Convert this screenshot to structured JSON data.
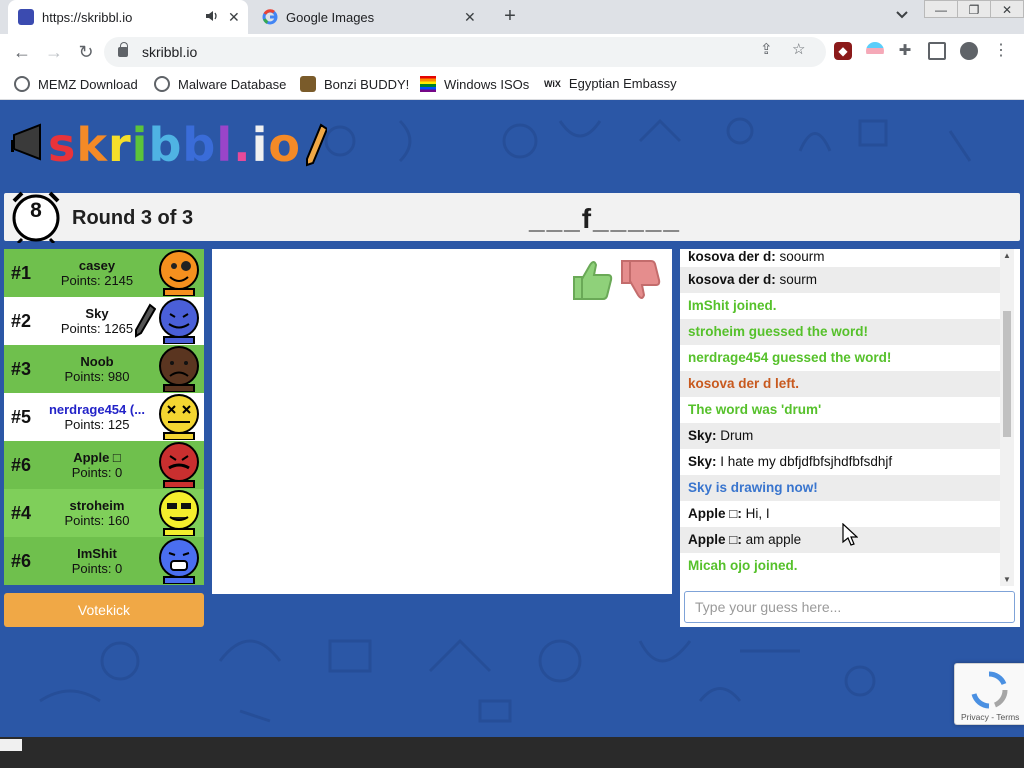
{
  "browser": {
    "tabs": [
      {
        "title": "https://skribbl.io",
        "active": true
      },
      {
        "title": "Google Images",
        "active": false
      }
    ],
    "new_tab_icon": "plus-icon",
    "url": "skribbl.io",
    "bookmarks": [
      {
        "label": "MEMZ Download"
      },
      {
        "label": "Malware Database"
      },
      {
        "label": "Bonzi BUDDY!"
      },
      {
        "label": "Windows ISOs"
      },
      {
        "label": "Egyptian Embassy"
      }
    ]
  },
  "game": {
    "logo_text": "skribbl.io",
    "timer": "8",
    "round": "Round 3 of 3",
    "word_hint": "___f_____",
    "players": [
      {
        "rank": "#1",
        "name": "casey",
        "points": "Points: 2145",
        "bg": "#6fc04d",
        "avatar_color": "#f5901e",
        "name_color": "#111111"
      },
      {
        "rank": "#2",
        "name": "Sky",
        "points": "Points: 1265",
        "bg": "#ffffff",
        "avatar_color": "#4a5fd8",
        "name_color": "#111111",
        "drawing": true
      },
      {
        "rank": "#3",
        "name": "Noob",
        "points": "Points: 980",
        "bg": "#6fc04d",
        "avatar_color": "#5a3520",
        "name_color": "#111111"
      },
      {
        "rank": "#5",
        "name": "nerdrage454 (...",
        "points": "Points: 125",
        "bg": "#ffffff",
        "avatar_color": "#f3d531",
        "name_color": "#2323c8"
      },
      {
        "rank": "#6",
        "name": "Apple □",
        "points": "Points: 0",
        "bg": "#6fc04d",
        "avatar_color": "#c92f2f",
        "name_color": "#111111"
      },
      {
        "rank": "#4",
        "name": "stroheim",
        "points": "Points: 160",
        "bg": "#7fcf5a",
        "avatar_color": "#f4ee2c",
        "name_color": "#111111"
      },
      {
        "rank": "#6",
        "name": "ImShit",
        "points": "Points: 0",
        "bg": "#6fc04d",
        "avatar_color": "#4a6ef0",
        "name_color": "#111111"
      }
    ],
    "votekick_label": "Votekick",
    "chat": [
      {
        "sender": "kosova der d:",
        "text": " soourm",
        "style": "normal"
      },
      {
        "sender": "kosova der d:",
        "text": " sourm",
        "style": "normal"
      },
      {
        "sender": "",
        "text": "ImShit joined.",
        "style": "green"
      },
      {
        "sender": "",
        "text": "stroheim guessed the word!",
        "style": "green"
      },
      {
        "sender": "",
        "text": "nerdrage454 guessed the word!",
        "style": "green"
      },
      {
        "sender": "",
        "text": "kosova der d left.",
        "style": "brown"
      },
      {
        "sender": "",
        "text": "The word was 'drum'",
        "style": "green"
      },
      {
        "sender": "Sky:",
        "text": " Drum",
        "style": "normal"
      },
      {
        "sender": "Sky:",
        "text": " I hate my dbfjdfbfsjhdfbfsdhjf",
        "style": "normal"
      },
      {
        "sender": "",
        "text": "Sky is drawing now!",
        "style": "blue"
      },
      {
        "sender": "Apple □:",
        "text": " Hi, I",
        "style": "normal"
      },
      {
        "sender": "Apple □:",
        "text": " am apple",
        "style": "normal"
      },
      {
        "sender": "",
        "text": "Micah ojo joined.",
        "style": "green"
      }
    ],
    "chat_placeholder": "Type your guess here...",
    "recaptcha_text": "Privacy - Terms"
  },
  "colors": {
    "page_bg": "#2b57a6",
    "green_msg": "#56c12b",
    "votekick": "#f0a846"
  }
}
